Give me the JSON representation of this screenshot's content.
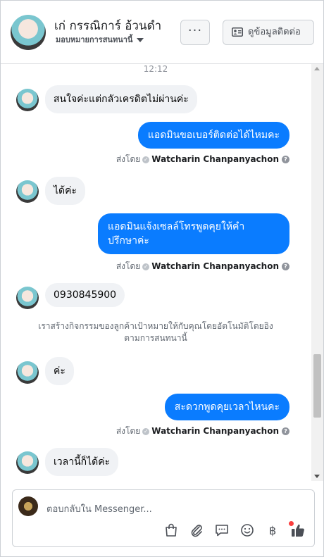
{
  "header": {
    "name": "เก่ กรรณิการ์ อ้วนดำ",
    "assign": "มอบหมายการสนทนานี้",
    "more_label": "···",
    "contact_label": "ดูข้อมูลติดต่อ"
  },
  "thread": {
    "timestamp": "12:12",
    "msg1": "สนใจค่ะแต่กลัวเครดิตไม่ผ่านค่ะ",
    "msg2": "แอดมินขอเบอร์ติดต่อได้ไหมคะ",
    "sent_by_label": "ส่งโดย",
    "sender": "Watcharin Chanpanyachon",
    "msg3": "ได้ค่ะ",
    "msg4_line1": "แอดมินแจ้งเซลล์โทรพูดคุยให้คำ",
    "msg4_line2": "ปรึกษาค่ะ",
    "msg5": "0930845900",
    "system_line1": "เราสร้างกิจกรรมของลูกค้าเป้าหมายให้กับคุณโดยอัตโนมัติโดยอิง",
    "system_line2": "ตามการสนทนานี้",
    "msg6": "ค่ะ",
    "msg7": "สะดวกพูดคุยเวลาไหนคะ",
    "msg8": "เวลานี้ก็ได้ค่ะ"
  },
  "composer": {
    "placeholder": "ตอบกลับใน Messenger..."
  },
  "colors": {
    "outgoing_bubble": "#0a7cff",
    "incoming_bubble": "#f0f2f5",
    "like_icon": "#4b4f56",
    "notification_dot": "#fa3e3e"
  },
  "icons": [
    "more-icon",
    "contact-card-icon",
    "shopping-bag-icon",
    "attachment-icon",
    "chat-bubble-icon",
    "emoji-icon",
    "baht-icon",
    "thumbs-up-icon"
  ]
}
